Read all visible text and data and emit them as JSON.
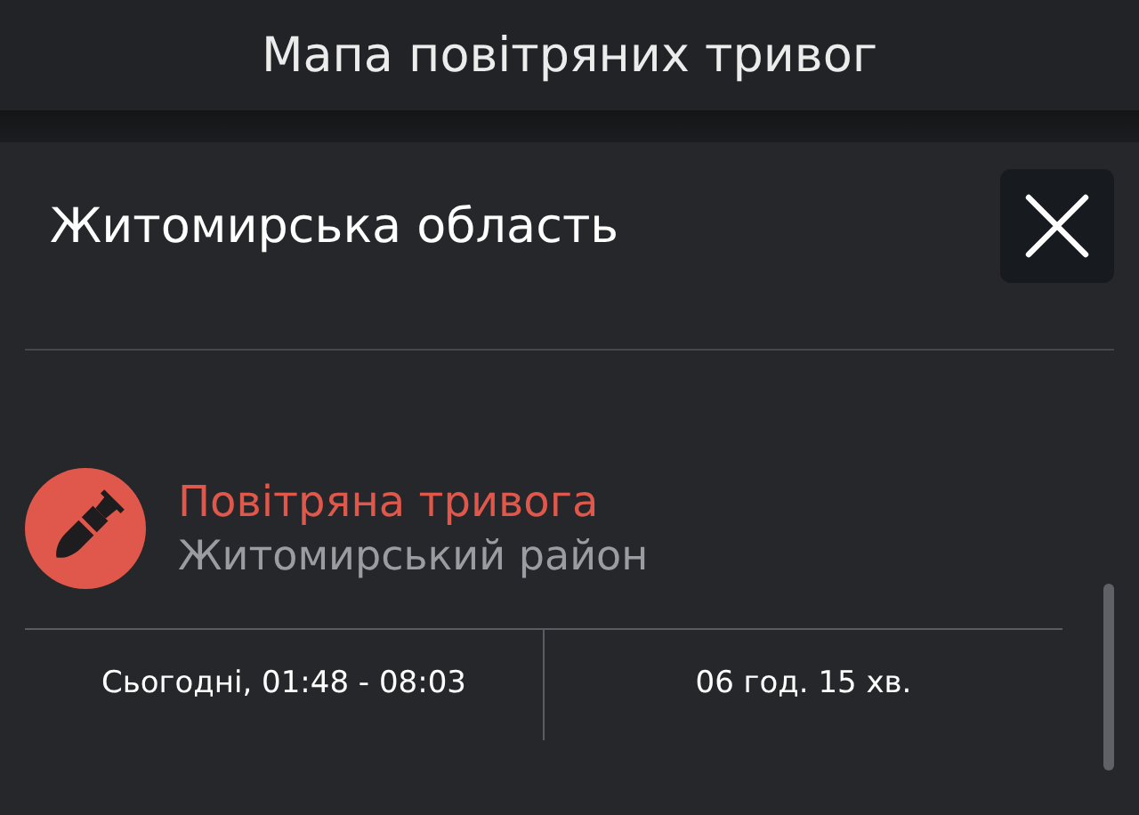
{
  "header": {
    "title": "Мапа повітряних тривог"
  },
  "panel": {
    "title": "Житомирська область",
    "alerts": [
      {
        "kind": "air_raid",
        "title": "Повітряна тривога",
        "district": "Житомирський район",
        "period": "Сьогодні, 01:48 - 08:03",
        "duration": "06 год. 15 хв."
      }
    ]
  }
}
